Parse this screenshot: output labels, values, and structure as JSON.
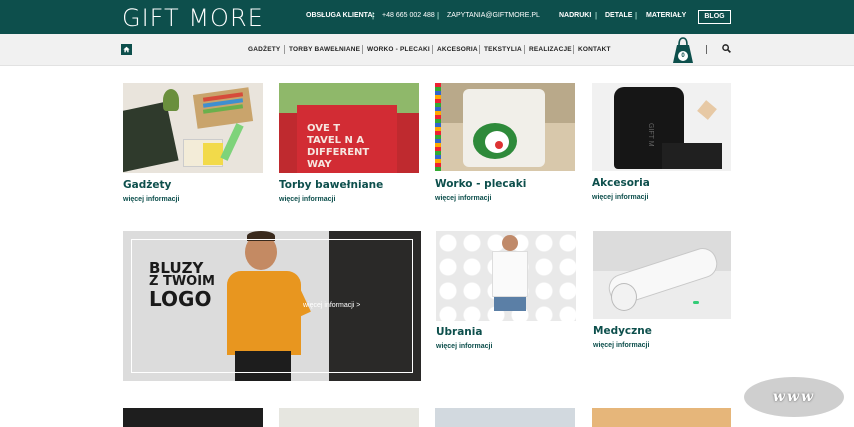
{
  "header": {
    "logo": "GIFT MORE",
    "customer_service_label": "OBSŁUGA KLIENTA:",
    "phone": "+48 665 002 488",
    "email": "ZAPYTANIA@GIFTMORE.PL",
    "links": [
      "NADRUKI",
      "DETALE",
      "MATERIAŁY"
    ],
    "blog": "BLOG",
    "separator": "|"
  },
  "nav": {
    "items": [
      "GADŻETY",
      "TORBY BAWEŁNIANE",
      "WORKO - PLECAKI",
      "AKCESORIA",
      "TEKSTYLIA",
      "REALIZACJE",
      "KONTAKT"
    ],
    "cart_count": "0"
  },
  "categories": [
    {
      "title": "Gadżety",
      "link": "więcej informacji"
    },
    {
      "title": "Torby bawełniane",
      "link": "więcej informacji"
    },
    {
      "title": "Worko - plecaki",
      "link": "więcej informacji"
    },
    {
      "title": "Akcesoria",
      "link": "więcej informacji"
    },
    {
      "title": "Ubrania",
      "link": "więcej informacji"
    },
    {
      "title": "Medyczne",
      "link": "więcej informacji"
    }
  ],
  "hero": {
    "line1": "BLUZY",
    "line2": "Z TWOIM",
    "line3": "LOGO",
    "link": "więcej informacji >"
  },
  "badge": "www",
  "colors": {
    "brand": "#0d4f4c"
  }
}
